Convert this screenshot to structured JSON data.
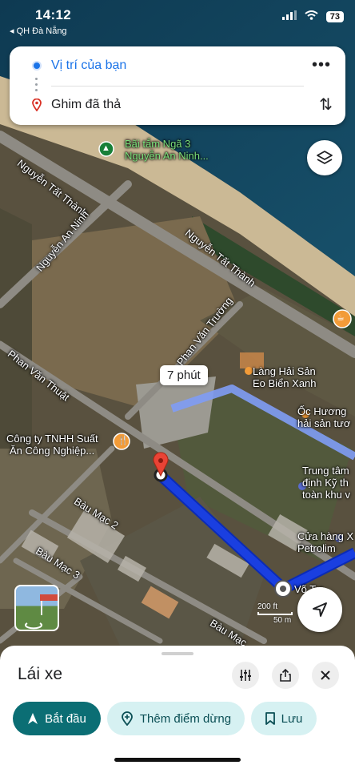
{
  "status_bar": {
    "time": "14:12",
    "back_label": "◂ QH Đà Nẵng",
    "battery": "73"
  },
  "route_card": {
    "origin": "Vị trí của bạn",
    "destination": "Ghim đã thả"
  },
  "map": {
    "labels": {
      "beach_poi": "Bãi tắm Ngã 3",
      "beach_poi_2": "Nguyễn An Ninh...",
      "nguyen_tat_thanh_1": "Nguyễn Tất Thành",
      "nguyen_tat_thanh_2": "Nguyễn Tất Thành",
      "nguyen_an_ninh": "Nguyễn An Ninh",
      "phan_van_truong": "Phan Văn Trường",
      "phan_van_thuat": "Phan Văn Thuật",
      "lang_hai_san": "Làng Hải Sản",
      "eo_bien_xanh": "Eo Biển Xanh",
      "oc_huong": "Ốc Hương",
      "hai_san_tuoi": "hải sản tươ",
      "cong_ty": "Công ty TNHH Suất",
      "an_cong_nghiep": "Ăn Công Nghiệp...",
      "trung_tam": "Trung tâm",
      "dinh_ky_thuat": "định Kỹ th",
      "toan_khu_vuc": "toàn khu v",
      "cua_hang": "Cửa hàng X",
      "petrolim": "Petrolim",
      "bau_mac_2": "Bàu Mạc 2",
      "bau_mac_3": "Bàu Mạc 3",
      "bau_mac": "Bàu Mạc",
      "vo_tuong": "Võ Tư"
    },
    "eta": "7 phút",
    "scale_ft": "200 ft",
    "scale_m": "50 m",
    "colors": {
      "route": "#1a3fe0",
      "route_outline": "#0b2bb5",
      "pin": "#ea4335"
    }
  },
  "sheet": {
    "title": "Lái xe",
    "start_label": "Bắt đầu",
    "add_stop_label": "Thêm điểm dừng",
    "save_label": "Lưu"
  }
}
